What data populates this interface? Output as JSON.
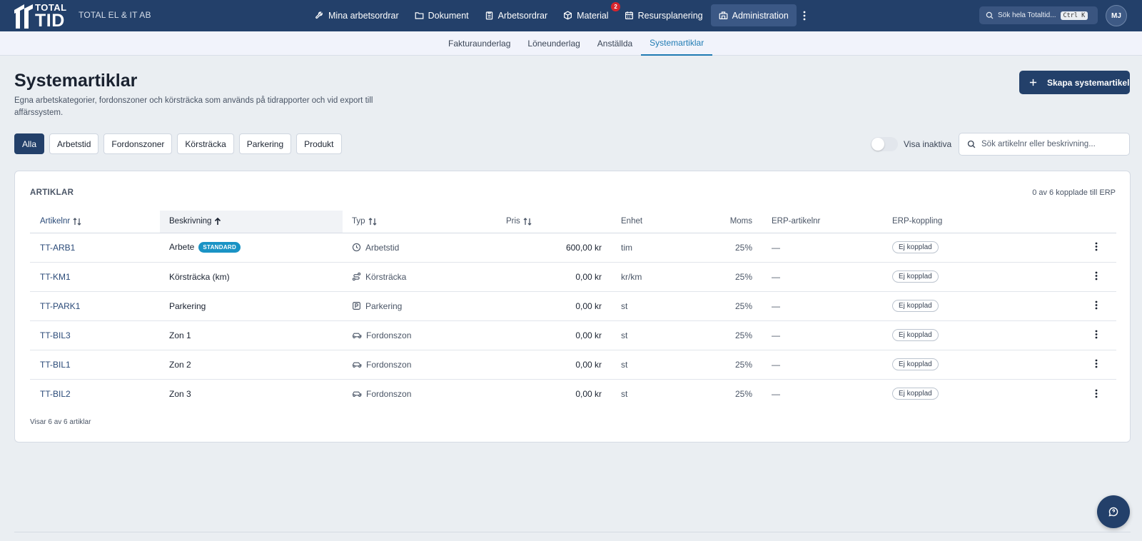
{
  "app": {
    "logo_top": "TOTAL",
    "logo_bottom": "TID",
    "company": "TOTAL EL & IT AB",
    "nav": [
      {
        "label": "Mina arbetsordrar",
        "icon": "wrench-icon"
      },
      {
        "label": "Dokument",
        "icon": "folder-icon"
      },
      {
        "label": "Arbetsordrar",
        "icon": "clipboard-icon"
      },
      {
        "label": "Material",
        "icon": "box-icon",
        "badge": "2"
      },
      {
        "label": "Resursplanering",
        "icon": "calendar-icon"
      },
      {
        "label": "Administration",
        "icon": "building-icon",
        "active": true
      }
    ],
    "search_placeholder": "Sök hela Totaltid...",
    "search_shortcut": "Ctrl K",
    "avatar": "MJ"
  },
  "subnav": {
    "tabs": [
      "Fakturaunderlag",
      "Löneunderlag",
      "Anställda",
      "Systemartiklar"
    ],
    "active": "Systemartiklar"
  },
  "header": {
    "title": "Systemartiklar",
    "description": "Egna arbetskategorier, fordonszoner och körsträcka som används på tidrapporter och vid export till affärssystem.",
    "create_label": "Skapa systemartikel"
  },
  "filters": {
    "chips": [
      "Alla",
      "Arbetstid",
      "Fordonszoner",
      "Körsträcka",
      "Parkering",
      "Produkt"
    ],
    "active": "Alla",
    "toggle_label": "Visa inaktiva",
    "toggle_on": false,
    "search_placeholder": "Sök artikelnr eller beskrivning..."
  },
  "card": {
    "title": "ARTIKLAR",
    "erp_count": "0 av 6 kopplade till ERP",
    "columns": [
      "Artikelnr",
      "Beskrivning",
      "Typ",
      "Pris",
      "Enhet",
      "Moms",
      "ERP-artikelnr",
      "ERP-koppling"
    ],
    "rows": [
      {
        "artikelnr": "TT-ARB1",
        "beskrivning": "Arbete",
        "badge": "STANDARD",
        "typ": "Arbetstid",
        "typ_icon": "clock-icon",
        "pris": "600,00 kr",
        "enhet": "tim",
        "moms": "25%",
        "erp_artikelnr": "—",
        "erp_koppling": "Ej kopplad"
      },
      {
        "artikelnr": "TT-KM1",
        "beskrivning": "Körsträcka (km)",
        "typ": "Körsträcka",
        "typ_icon": "route-icon",
        "pris": "0,00 kr",
        "enhet": "kr/km",
        "moms": "25%",
        "erp_artikelnr": "—",
        "erp_koppling": "Ej kopplad"
      },
      {
        "artikelnr": "TT-PARK1",
        "beskrivning": "Parkering",
        "typ": "Parkering",
        "typ_icon": "parking-icon",
        "pris": "0,00 kr",
        "enhet": "st",
        "moms": "25%",
        "erp_artikelnr": "—",
        "erp_koppling": "Ej kopplad"
      },
      {
        "artikelnr": "TT-BIL3",
        "beskrivning": "Zon 1",
        "typ": "Fordonszon",
        "typ_icon": "car-icon",
        "pris": "0,00 kr",
        "enhet": "st",
        "moms": "25%",
        "erp_artikelnr": "—",
        "erp_koppling": "Ej kopplad"
      },
      {
        "artikelnr": "TT-BIL1",
        "beskrivning": "Zon 2",
        "typ": "Fordonszon",
        "typ_icon": "car-icon",
        "pris": "0,00 kr",
        "enhet": "st",
        "moms": "25%",
        "erp_artikelnr": "—",
        "erp_koppling": "Ej kopplad"
      },
      {
        "artikelnr": "TT-BIL2",
        "beskrivning": "Zon 3",
        "typ": "Fordonszon",
        "typ_icon": "car-icon",
        "pris": "0,00 kr",
        "enhet": "st",
        "moms": "25%",
        "erp_artikelnr": "—",
        "erp_koppling": "Ej kopplad"
      }
    ],
    "footer": "Visar 6 av 6 artiklar"
  },
  "colors": {
    "brand": "#23406a",
    "accent": "#1f7bb3",
    "badge_red": "#d8242c",
    "standard_badge": "#1a93c5"
  }
}
